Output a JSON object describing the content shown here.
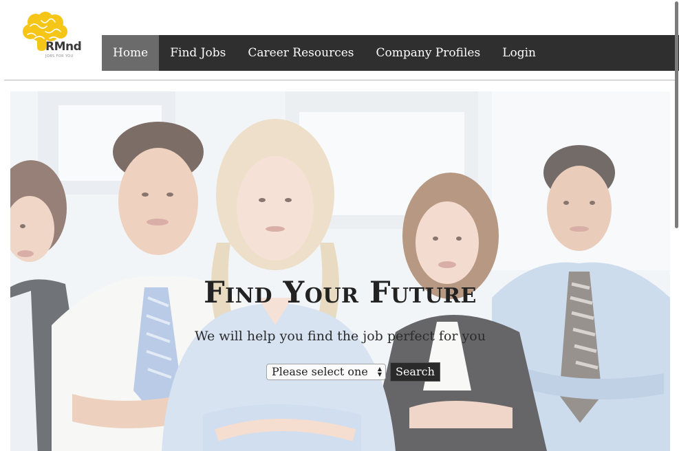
{
  "brand": {
    "name": "RMnd",
    "tagline": "JOBS FOR YOU",
    "accent_color": "#f5c518",
    "logo_icon": "brain-icon"
  },
  "nav": {
    "items": [
      {
        "label": "Home",
        "active": true
      },
      {
        "label": "Find Jobs",
        "active": false
      },
      {
        "label": "Career Resources",
        "active": false
      },
      {
        "label": "Company Profiles",
        "active": false
      },
      {
        "label": "Login",
        "active": false
      }
    ],
    "background_color": "#2f2f2f",
    "active_color": "#6b6b6b"
  },
  "hero": {
    "title": "Find Your Future",
    "subtitle": "We will help you find the job perfect for you",
    "select_value": "Please select one",
    "search_label": "Search",
    "image": "team-of-professionals-photo"
  }
}
